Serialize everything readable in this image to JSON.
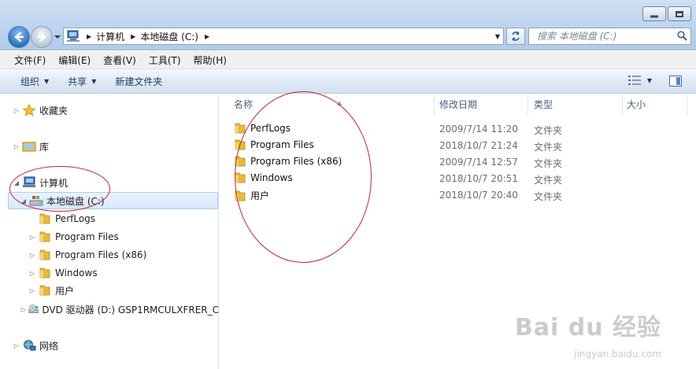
{
  "address": {
    "crumbs": [
      "计算机",
      "本地磁盘 (C:)"
    ]
  },
  "search": {
    "placeholder": "搜索 本地磁盘 (C:)"
  },
  "menu": [
    "文件(F)",
    "编辑(E)",
    "查看(V)",
    "工具(T)",
    "帮助(H)"
  ],
  "commands": {
    "organize": "组织",
    "share": "共享",
    "new_folder": "新建文件夹"
  },
  "nav": {
    "favorites": "收藏夹",
    "libraries": "库",
    "computer": "计算机",
    "local_disk": "本地磁盘 (C:)",
    "folders": [
      "PerfLogs",
      "Program Files",
      "Program Files (x86)",
      "Windows",
      "用户"
    ],
    "dvd": "DVD 驱动器 (D:) GSP1RMCULXFRER_C",
    "network": "网络"
  },
  "columns": {
    "name": "名称",
    "date": "修改日期",
    "type": "类型",
    "size": "大小"
  },
  "files": [
    {
      "name": "PerfLogs",
      "date": "2009/7/14 11:20",
      "type": "文件夹"
    },
    {
      "name": "Program Files",
      "date": "2018/10/7 21:24",
      "type": "文件夹"
    },
    {
      "name": "Program Files (x86)",
      "date": "2009/7/14 12:57",
      "type": "文件夹"
    },
    {
      "name": "Windows",
      "date": "2018/10/7 20:51",
      "type": "文件夹"
    },
    {
      "name": "用户",
      "date": "2018/10/7 20:40",
      "type": "文件夹"
    }
  ],
  "watermark": {
    "brand": "Bai du 经验",
    "url": "jingyan.baidu.com"
  }
}
